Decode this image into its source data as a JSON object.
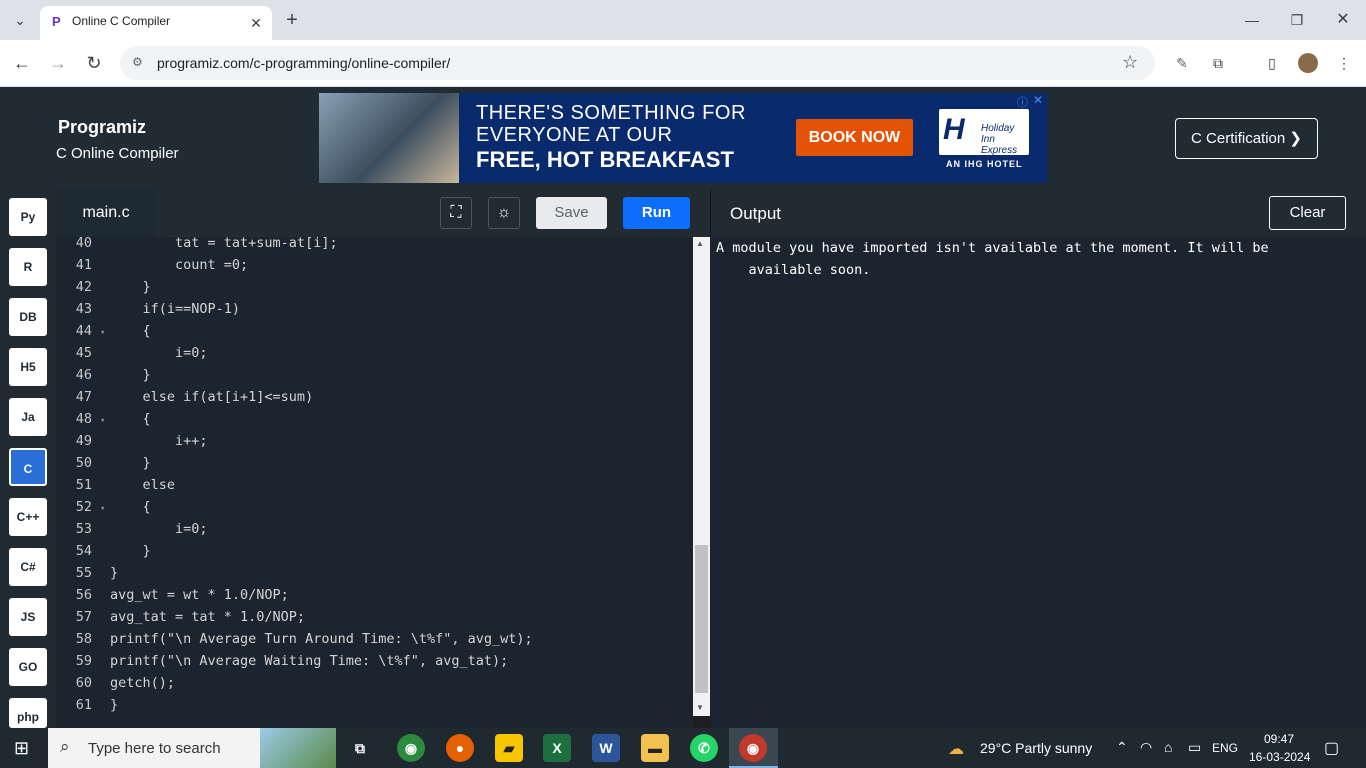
{
  "browser": {
    "tab_title": "Online C Compiler",
    "url": "programiz.com/c-programming/online-compiler/"
  },
  "header": {
    "brand": "Programiz",
    "subtitle": "C Online Compiler",
    "cert_button": "C Certification ❯"
  },
  "ad": {
    "line1": "THERE'S SOMETHING FOR",
    "line2": "EVERYONE AT OUR",
    "bold": "FREE, HOT BREAKFAST",
    "cta": "BOOK NOW",
    "logo": "Holiday Inn Express",
    "tagline": "AN IHG HOTEL"
  },
  "sidebar": {
    "languages": [
      "Py",
      "R",
      "DB",
      "H5",
      "Ja",
      "C",
      "C++",
      "C#",
      "JS",
      "GO",
      "php"
    ],
    "active": "C"
  },
  "editor": {
    "file": "main.c",
    "save": "Save",
    "run": "Run",
    "lines": [
      {
        "n": "40",
        "f": "",
        "c": "        tat = tat+sum-at[i];"
      },
      {
        "n": "41",
        "f": "",
        "c": "        count =0;"
      },
      {
        "n": "42",
        "f": "",
        "c": "    }"
      },
      {
        "n": "43",
        "f": "",
        "c": "    if(i==NOP-1)"
      },
      {
        "n": "44",
        "f": "▾",
        "c": "    {"
      },
      {
        "n": "45",
        "f": "",
        "c": "        i=0;"
      },
      {
        "n": "46",
        "f": "",
        "c": "    }"
      },
      {
        "n": "47",
        "f": "",
        "c": "    else if(at[i+1]<=sum)"
      },
      {
        "n": "48",
        "f": "▾",
        "c": "    {"
      },
      {
        "n": "49",
        "f": "",
        "c": "        i++;"
      },
      {
        "n": "50",
        "f": "",
        "c": "    }"
      },
      {
        "n": "51",
        "f": "",
        "c": "    else"
      },
      {
        "n": "52",
        "f": "▾",
        "c": "    {"
      },
      {
        "n": "53",
        "f": "",
        "c": "        i=0;"
      },
      {
        "n": "54",
        "f": "",
        "c": "    }"
      },
      {
        "n": "55",
        "f": "",
        "c": "}"
      },
      {
        "n": "56",
        "f": "",
        "c": "avg_wt = wt * 1.0/NOP;"
      },
      {
        "n": "57",
        "f": "",
        "c": "avg_tat = tat * 1.0/NOP;"
      },
      {
        "n": "58",
        "f": "",
        "c": "printf(\"\\n Average Turn Around Time: \\t%f\", avg_wt);"
      },
      {
        "n": "59",
        "f": "",
        "c": "printf(\"\\n Average Waiting Time: \\t%f\", avg_tat);"
      },
      {
        "n": "60",
        "f": "",
        "c": "getch();"
      },
      {
        "n": "61",
        "f": "",
        "c": "}"
      }
    ]
  },
  "output": {
    "title": "Output",
    "clear": "Clear",
    "text": "A module you have imported isn't available at the moment. It will be\n    available soon."
  },
  "taskbar": {
    "search_placeholder": "Type here to search",
    "weather": "29°C  Partly sunny",
    "lang": "ENG",
    "time": "09:47",
    "date": "16-03-2024"
  }
}
